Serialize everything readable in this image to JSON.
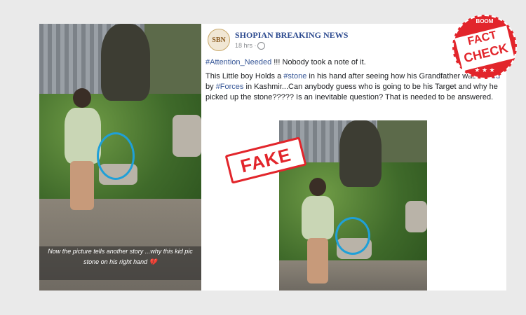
{
  "left_photo": {
    "caption_text": "Now the picture tells another story ...why this kid pic stone on his right hand",
    "caption_emoji": "💔"
  },
  "post": {
    "page_name": "SHOPIAN BREAKING NEWS",
    "avatar_text": "SBN",
    "time": "18 hrs ·",
    "line1_tag": "#Attention_Needed",
    "line1_rest": " !!! Nobody took a note of it.",
    "body_parts": [
      "This Little boy Holds a ",
      "#stone",
      " in his hand after seeing how his Grandfather was ",
      "#killed",
      " by ",
      "#Forces",
      " in Kashmir...Can anybody guess who is going to be his Target and why he picked up the stone????? Is an inevitable question? That is needed to be answered."
    ]
  },
  "fake_stamp": "FAKE",
  "badge": {
    "top": "BOOM",
    "line1": "FACT",
    "line2": "CHECK",
    "stars": "★ ★ ★"
  },
  "colors": {
    "stamp_red": "#e2252b",
    "link_blue": "#385898",
    "circle_blue": "#1fa0d8"
  }
}
